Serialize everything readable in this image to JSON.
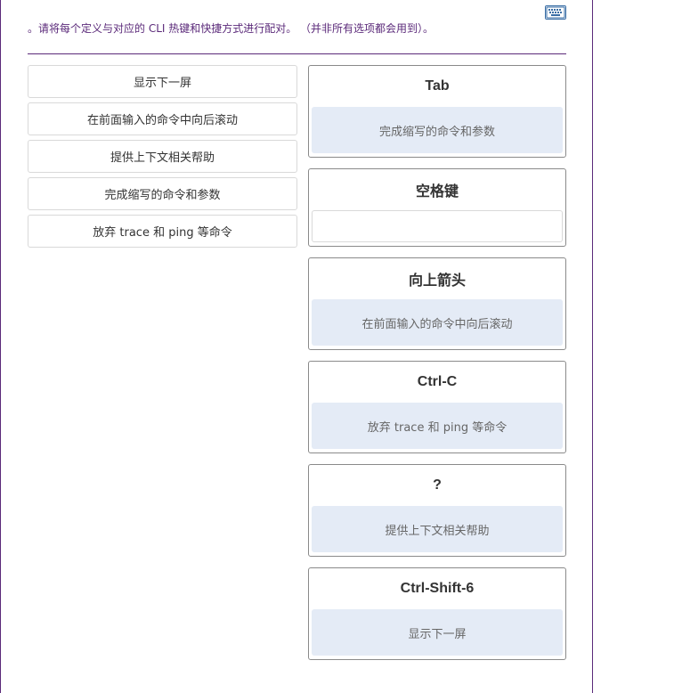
{
  "instruction": "。请将每个定义与对应的 CLI 热键和快捷方式进行配对。 （并非所有选项都会用到）。",
  "options": [
    "显示下一屏",
    "在前面输入的命令中向后滚动",
    "提供上下文相关帮助",
    "完成缩写的命令和参数",
    "放弃 trace 和 ping 等命令"
  ],
  "targets": [
    {
      "label": "Tab",
      "answer": "完成缩写的命令和参数"
    },
    {
      "label": "空格键",
      "answer": ""
    },
    {
      "label": "向上箭头",
      "answer": "在前面输入的命令中向后滚动"
    },
    {
      "label": "Ctrl-C",
      "answer": "放弃 trace 和 ping 等命令"
    },
    {
      "label": "?",
      "answer": "提供上下文相关帮助"
    },
    {
      "label": "Ctrl-Shift-6",
      "answer": "显示下一屏"
    }
  ],
  "icons": {
    "keyboard": "keyboard-icon"
  },
  "colors": {
    "accent": "#5b2a7a",
    "drop_zone_fill": "#e4ebf6",
    "link_blue": "#3a6ea5"
  }
}
